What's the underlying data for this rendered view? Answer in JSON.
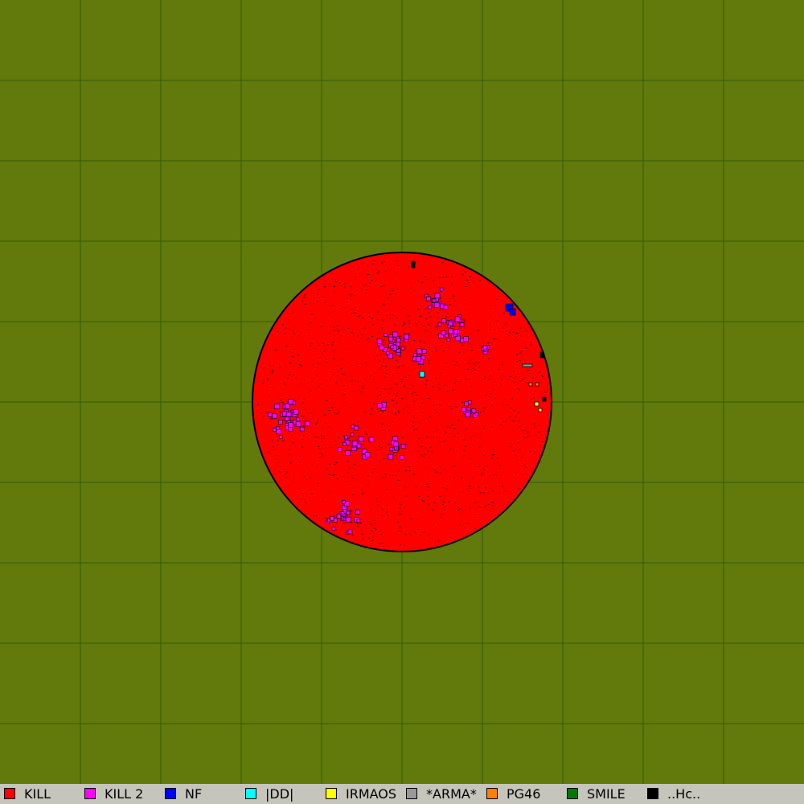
{
  "map": {
    "background_color": "#617a0b",
    "grid_color": "#345b0c",
    "grid_size": 10,
    "outline_color": "#000000"
  },
  "players": [
    {
      "name": "KILL",
      "color": "#ff0000",
      "icon": "red-swatch"
    },
    {
      "name": "KILL 2",
      "color": "#ff00ff",
      "icon": "magenta-swatch"
    },
    {
      "name": "NF",
      "color": "#0000ff",
      "icon": "blue-swatch"
    },
    {
      "name": "|DD|",
      "color": "#00ffff",
      "icon": "cyan-swatch"
    },
    {
      "name": "IRMAOS",
      "color": "#ffff00",
      "icon": "yellow-swatch"
    },
    {
      "name": "*ARMA*",
      "color": "#999999",
      "icon": "gray-swatch"
    },
    {
      "name": "PG46",
      "color": "#ff8000",
      "icon": "orange-swatch"
    },
    {
      "name": "SMILE",
      "color": "#007700",
      "icon": "green-swatch"
    },
    {
      "name": "..Hc..",
      "color": "#000000",
      "icon": "black-swatch"
    }
  ]
}
